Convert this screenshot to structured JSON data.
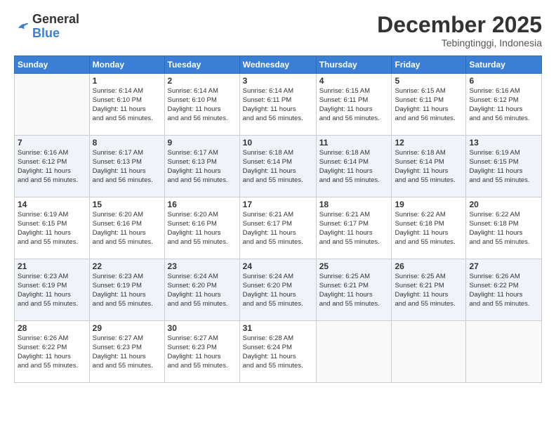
{
  "logo": {
    "general": "General",
    "blue": "Blue"
  },
  "title": "December 2025",
  "location": "Tebingtinggi, Indonesia",
  "days_header": [
    "Sunday",
    "Monday",
    "Tuesday",
    "Wednesday",
    "Thursday",
    "Friday",
    "Saturday"
  ],
  "weeks": [
    [
      {
        "day": "",
        "sunrise": "",
        "sunset": "",
        "daylight": ""
      },
      {
        "day": "1",
        "sunrise": "Sunrise: 6:14 AM",
        "sunset": "Sunset: 6:10 PM",
        "daylight": "Daylight: 11 hours and 56 minutes."
      },
      {
        "day": "2",
        "sunrise": "Sunrise: 6:14 AM",
        "sunset": "Sunset: 6:10 PM",
        "daylight": "Daylight: 11 hours and 56 minutes."
      },
      {
        "day": "3",
        "sunrise": "Sunrise: 6:14 AM",
        "sunset": "Sunset: 6:11 PM",
        "daylight": "Daylight: 11 hours and 56 minutes."
      },
      {
        "day": "4",
        "sunrise": "Sunrise: 6:15 AM",
        "sunset": "Sunset: 6:11 PM",
        "daylight": "Daylight: 11 hours and 56 minutes."
      },
      {
        "day": "5",
        "sunrise": "Sunrise: 6:15 AM",
        "sunset": "Sunset: 6:11 PM",
        "daylight": "Daylight: 11 hours and 56 minutes."
      },
      {
        "day": "6",
        "sunrise": "Sunrise: 6:16 AM",
        "sunset": "Sunset: 6:12 PM",
        "daylight": "Daylight: 11 hours and 56 minutes."
      }
    ],
    [
      {
        "day": "7",
        "sunrise": "Sunrise: 6:16 AM",
        "sunset": "Sunset: 6:12 PM",
        "daylight": "Daylight: 11 hours and 56 minutes."
      },
      {
        "day": "8",
        "sunrise": "Sunrise: 6:17 AM",
        "sunset": "Sunset: 6:13 PM",
        "daylight": "Daylight: 11 hours and 56 minutes."
      },
      {
        "day": "9",
        "sunrise": "Sunrise: 6:17 AM",
        "sunset": "Sunset: 6:13 PM",
        "daylight": "Daylight: 11 hours and 56 minutes."
      },
      {
        "day": "10",
        "sunrise": "Sunrise: 6:18 AM",
        "sunset": "Sunset: 6:14 PM",
        "daylight": "Daylight: 11 hours and 55 minutes."
      },
      {
        "day": "11",
        "sunrise": "Sunrise: 6:18 AM",
        "sunset": "Sunset: 6:14 PM",
        "daylight": "Daylight: 11 hours and 55 minutes."
      },
      {
        "day": "12",
        "sunrise": "Sunrise: 6:18 AM",
        "sunset": "Sunset: 6:14 PM",
        "daylight": "Daylight: 11 hours and 55 minutes."
      },
      {
        "day": "13",
        "sunrise": "Sunrise: 6:19 AM",
        "sunset": "Sunset: 6:15 PM",
        "daylight": "Daylight: 11 hours and 55 minutes."
      }
    ],
    [
      {
        "day": "14",
        "sunrise": "Sunrise: 6:19 AM",
        "sunset": "Sunset: 6:15 PM",
        "daylight": "Daylight: 11 hours and 55 minutes."
      },
      {
        "day": "15",
        "sunrise": "Sunrise: 6:20 AM",
        "sunset": "Sunset: 6:16 PM",
        "daylight": "Daylight: 11 hours and 55 minutes."
      },
      {
        "day": "16",
        "sunrise": "Sunrise: 6:20 AM",
        "sunset": "Sunset: 6:16 PM",
        "daylight": "Daylight: 11 hours and 55 minutes."
      },
      {
        "day": "17",
        "sunrise": "Sunrise: 6:21 AM",
        "sunset": "Sunset: 6:17 PM",
        "daylight": "Daylight: 11 hours and 55 minutes."
      },
      {
        "day": "18",
        "sunrise": "Sunrise: 6:21 AM",
        "sunset": "Sunset: 6:17 PM",
        "daylight": "Daylight: 11 hours and 55 minutes."
      },
      {
        "day": "19",
        "sunrise": "Sunrise: 6:22 AM",
        "sunset": "Sunset: 6:18 PM",
        "daylight": "Daylight: 11 hours and 55 minutes."
      },
      {
        "day": "20",
        "sunrise": "Sunrise: 6:22 AM",
        "sunset": "Sunset: 6:18 PM",
        "daylight": "Daylight: 11 hours and 55 minutes."
      }
    ],
    [
      {
        "day": "21",
        "sunrise": "Sunrise: 6:23 AM",
        "sunset": "Sunset: 6:19 PM",
        "daylight": "Daylight: 11 hours and 55 minutes."
      },
      {
        "day": "22",
        "sunrise": "Sunrise: 6:23 AM",
        "sunset": "Sunset: 6:19 PM",
        "daylight": "Daylight: 11 hours and 55 minutes."
      },
      {
        "day": "23",
        "sunrise": "Sunrise: 6:24 AM",
        "sunset": "Sunset: 6:20 PM",
        "daylight": "Daylight: 11 hours and 55 minutes."
      },
      {
        "day": "24",
        "sunrise": "Sunrise: 6:24 AM",
        "sunset": "Sunset: 6:20 PM",
        "daylight": "Daylight: 11 hours and 55 minutes."
      },
      {
        "day": "25",
        "sunrise": "Sunrise: 6:25 AM",
        "sunset": "Sunset: 6:21 PM",
        "daylight": "Daylight: 11 hours and 55 minutes."
      },
      {
        "day": "26",
        "sunrise": "Sunrise: 6:25 AM",
        "sunset": "Sunset: 6:21 PM",
        "daylight": "Daylight: 11 hours and 55 minutes."
      },
      {
        "day": "27",
        "sunrise": "Sunrise: 6:26 AM",
        "sunset": "Sunset: 6:22 PM",
        "daylight": "Daylight: 11 hours and 55 minutes."
      }
    ],
    [
      {
        "day": "28",
        "sunrise": "Sunrise: 6:26 AM",
        "sunset": "Sunset: 6:22 PM",
        "daylight": "Daylight: 11 hours and 55 minutes."
      },
      {
        "day": "29",
        "sunrise": "Sunrise: 6:27 AM",
        "sunset": "Sunset: 6:23 PM",
        "daylight": "Daylight: 11 hours and 55 minutes."
      },
      {
        "day": "30",
        "sunrise": "Sunrise: 6:27 AM",
        "sunset": "Sunset: 6:23 PM",
        "daylight": "Daylight: 11 hours and 55 minutes."
      },
      {
        "day": "31",
        "sunrise": "Sunrise: 6:28 AM",
        "sunset": "Sunset: 6:24 PM",
        "daylight": "Daylight: 11 hours and 55 minutes."
      },
      {
        "day": "",
        "sunrise": "",
        "sunset": "",
        "daylight": ""
      },
      {
        "day": "",
        "sunrise": "",
        "sunset": "",
        "daylight": ""
      },
      {
        "day": "",
        "sunrise": "",
        "sunset": "",
        "daylight": ""
      }
    ]
  ]
}
